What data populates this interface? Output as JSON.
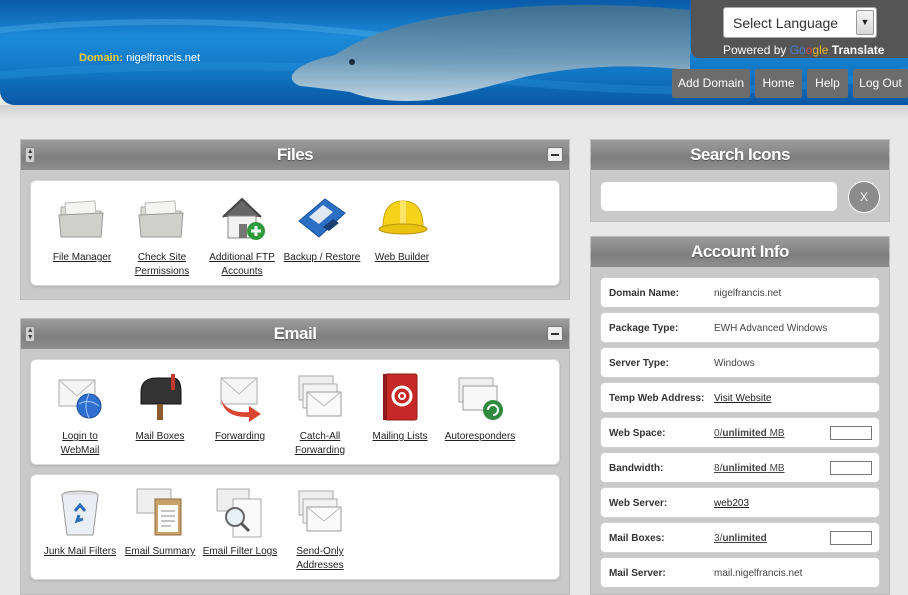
{
  "header": {
    "domain_label": "Domain:",
    "domain_value": "nigelfrancis.net",
    "language_select": "Select Language",
    "powered_by": "Powered by",
    "google_g1": "Go",
    "google_g2": "o",
    "google_g3": "gle",
    "translate": "Translate",
    "nav": [
      "Add Domain",
      "Home",
      "Help",
      "Log Out"
    ]
  },
  "files_panel": {
    "title": "Files",
    "tiles": [
      {
        "line1": "File Manager",
        "line2": "",
        "icon": "folder-icon"
      },
      {
        "line1": "Check Site",
        "line2": "Permissions",
        "icon": "folder-icon"
      },
      {
        "line1": "Additional FTP",
        "line2": "Accounts",
        "icon": "house-add-icon"
      },
      {
        "line1": "Backup / Restore",
        "line2": "",
        "icon": "floppy-disk-icon"
      },
      {
        "line1": "Web Builder",
        "line2": "",
        "icon": "hard-hat-icon"
      }
    ]
  },
  "email_panel": {
    "title": "Email",
    "tiles_row1": [
      {
        "line1": "Login to",
        "line2": "WebMail",
        "icon": "envelope-globe-icon"
      },
      {
        "line1": "Mail Boxes",
        "line2": "",
        "icon": "mailbox-icon"
      },
      {
        "line1": "Forwarding",
        "line2": "",
        "icon": "envelope-forward-icon"
      },
      {
        "line1": "Catch-All",
        "line2": "Forwarding",
        "icon": "envelope-stack-icon"
      },
      {
        "line1": "Mailing Lists",
        "line2": "",
        "icon": "address-book-icon"
      },
      {
        "line1": "Autoresponders",
        "line2": "",
        "icon": "envelope-refresh-icon"
      }
    ],
    "tiles_row2": [
      {
        "line1": "Junk Mail Filters",
        "line2": "",
        "icon": "recycle-bin-icon"
      },
      {
        "line1": "Email Summary",
        "line2": "",
        "icon": "envelope-clipboard-icon"
      },
      {
        "line1": "Email Filter Logs",
        "line2": "",
        "icon": "document-search-icon"
      },
      {
        "line1": "Send-Only",
        "line2": "Addresses",
        "icon": "envelope-stack-icon"
      }
    ]
  },
  "search_panel": {
    "title": "Search Icons",
    "clear_label": "X"
  },
  "account_panel": {
    "title": "Account Info",
    "rows": [
      {
        "key": "Domain Name:",
        "value": "nigelfrancis.net"
      },
      {
        "key": "Package Type:",
        "value": "EWH Advanced Windows"
      },
      {
        "key": "Server Type:",
        "value": "Windows"
      },
      {
        "key": "Temp Web Address:",
        "value": "Visit Website"
      },
      {
        "key": "Web Space:",
        "value_used": "0",
        "value_sep": "/",
        "value_limit": "unlimited",
        "value_unit": " MB",
        "usage": 0
      },
      {
        "key": "Bandwidth:",
        "value_used": "8",
        "value_sep": "/",
        "value_limit": "unlimited",
        "value_unit": " MB",
        "usage": 0
      },
      {
        "key": "Web Server:",
        "value": "web203"
      },
      {
        "key": "Mail Boxes:",
        "value_used": "3",
        "value_sep": "/",
        "value_limit": "unlimited",
        "value_unit": "",
        "usage": 0
      },
      {
        "key": "Mail Server:",
        "value": "mail.nigelfrancis.net"
      }
    ]
  }
}
